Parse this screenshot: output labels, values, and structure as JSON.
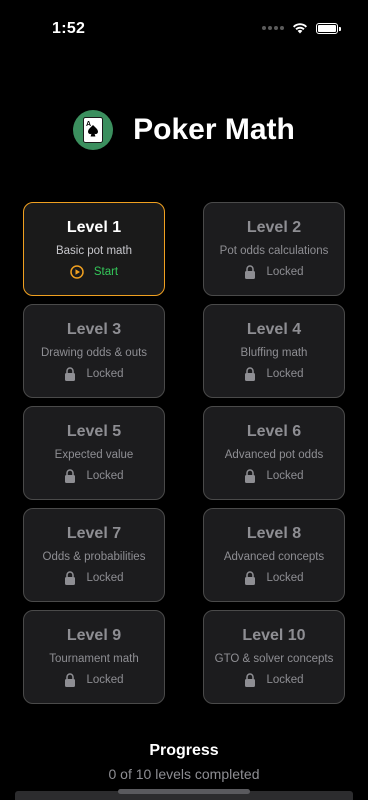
{
  "status_bar": {
    "time": "1:52"
  },
  "header": {
    "title": "Poker Math",
    "logo_card_rank": "A",
    "logo_icon": "spade-card-icon"
  },
  "levels": [
    {
      "title": "Level 1",
      "subtitle": "Basic pot math",
      "status": "Start",
      "state": "unlocked"
    },
    {
      "title": "Level 2",
      "subtitle": "Pot odds calculations",
      "status": "Locked",
      "state": "locked"
    },
    {
      "title": "Level 3",
      "subtitle": "Drawing odds & outs",
      "status": "Locked",
      "state": "locked"
    },
    {
      "title": "Level 4",
      "subtitle": "Bluffing math",
      "status": "Locked",
      "state": "locked"
    },
    {
      "title": "Level 5",
      "subtitle": "Expected value",
      "status": "Locked",
      "state": "locked"
    },
    {
      "title": "Level 6",
      "subtitle": "Advanced pot odds",
      "status": "Locked",
      "state": "locked"
    },
    {
      "title": "Level 7",
      "subtitle": "Odds & probabilities",
      "status": "Locked",
      "state": "locked"
    },
    {
      "title": "Level 8",
      "subtitle": "Advanced concepts",
      "status": "Locked",
      "state": "locked"
    },
    {
      "title": "Level 9",
      "subtitle": "Tournament math",
      "status": "Locked",
      "state": "locked"
    },
    {
      "title": "Level 10",
      "subtitle": "GTO & solver concepts",
      "status": "Locked",
      "state": "locked"
    }
  ],
  "progress": {
    "title": "Progress",
    "text": "0 of 10 levels completed",
    "completed": 0,
    "total": 10
  },
  "colors": {
    "accent": "#f0a020",
    "start_green": "#34c759",
    "logo_green": "#3b8f5e",
    "card_bg": "#1c1c1e",
    "muted_text": "#8e8e93"
  }
}
